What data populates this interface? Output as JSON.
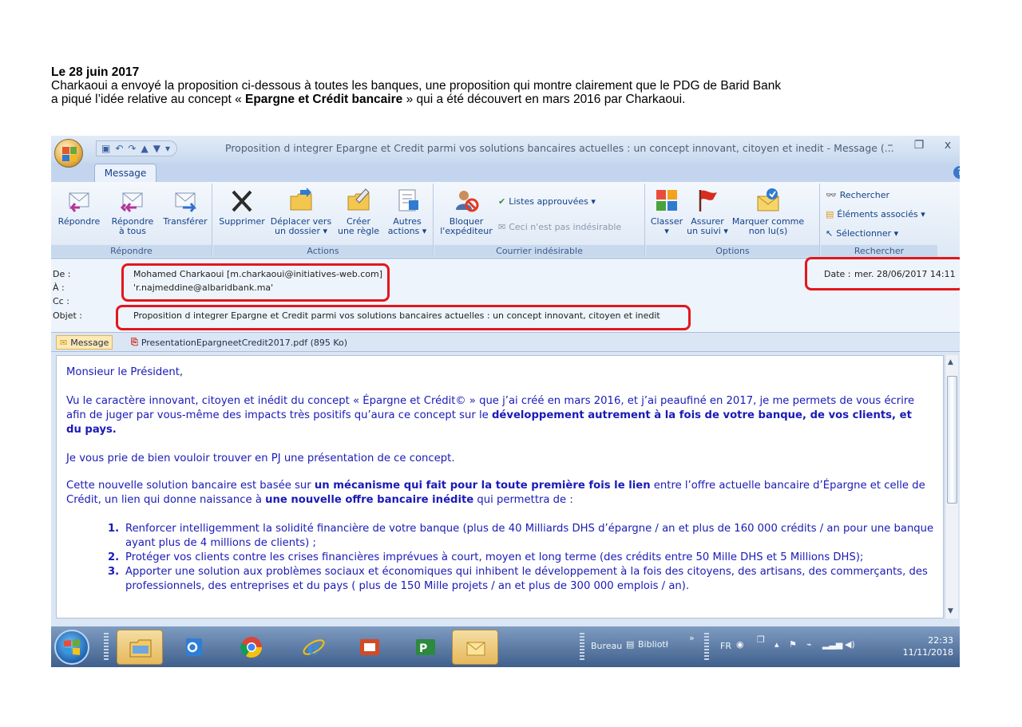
{
  "intro": {
    "date": "Le 28 juin 2017",
    "line1": "Charkaoui a envoyé la proposition ci-dessous à toutes les banques, une proposition qui montre clairement que le PDG de Barid Bank",
    "line2_pre": "a piqué l’idée relative au concept « ",
    "line2_bold": "Epargne et Crédit bancaire",
    "line2_post": " » qui a été découvert en mars 2016 par Charkaoui."
  },
  "window": {
    "title": "Proposition d integrer Epargne et Credit parmi vos solutions bancaires actuelles : un concept innovant, citoyen et inedit  - Message (...",
    "minimize": "–",
    "restore": "❐",
    "close": "x",
    "tab": "Message",
    "help": "?"
  },
  "ribbon": {
    "repondre": {
      "label": "Répondre",
      "reply": "Répondre",
      "reply_all_1": "Répondre",
      "reply_all_2": "à tous",
      "forward": "Transférer"
    },
    "actions": {
      "label": "Actions",
      "delete": "Supprimer",
      "move_1": "Déplacer vers",
      "move_2": "un dossier ▾",
      "rule_1": "Créer",
      "rule_2": "une règle",
      "other_1": "Autres",
      "other_2": "actions ▾"
    },
    "junk": {
      "label": "Courrier indésirable",
      "block_1": "Bloquer",
      "block_2": "l'expéditeur",
      "safe_lists": "Listes approuvées ▾",
      "not_junk": "Ceci n'est pas indésirable"
    },
    "options": {
      "label": "Options",
      "classify_1": "Classer",
      "classify_2": "▾",
      "followup_1": "Assurer",
      "followup_2": "un suivi ▾",
      "unread_1": "Marquer comme",
      "unread_2": "non lu(s)"
    },
    "search": {
      "label": "Rechercher",
      "find": "Rechercher",
      "related": "Éléments associés ▾",
      "select": "Sélectionner ▾"
    }
  },
  "header": {
    "from_label": "De :",
    "from_value": "Mohamed Charkaoui  [m.charkaoui@initiatives-web.com]",
    "to_label": "À :",
    "to_value": "'r.najmeddine@albaridbank.ma'",
    "cc_label": "Cc :",
    "subject_label": "Objet :",
    "subject_value": "Proposition d integrer Epargne et Credit parmi vos solutions bancaires actuelles : un concept innovant, citoyen et inedit",
    "date_label": "Date :",
    "date_value": "mer. 28/06/2017 14:11"
  },
  "attachments": {
    "message_tab": "Message",
    "file": "PresentationEpargneetCredit2017.pdf (895 Ko)"
  },
  "body": {
    "greeting": "Monsieur le Président,",
    "p1_text": "Vu le caractère innovant, citoyen et inédit du  concept « Épargne et Crédit© » que j’ai créé en mars 2016, et j’ai peaufiné en 2017, je me permets de vous écrire afin de juger par vous-même des impacts très positifs qu’aura ce concept sur le ",
    "p1_bold": "développement autrement à la fois de votre banque, de vos clients, et du pays.",
    "p2": "Je vous prie de bien vouloir trouver en PJ une présentation de ce concept.",
    "p3_a": "Cette nouvelle solution bancaire est basée sur ",
    "p3_b": "un mécanisme qui fait pour la toute première fois le lien",
    "p3_c": " entre l’offre actuelle bancaire  d’Épargne et celle de Crédit, un lien qui  donne naissance à ",
    "p3_d": "une nouvelle offre bancaire inédite",
    "p3_e": " qui permettra de :",
    "items": [
      {
        "num": "1.",
        "text": "Renforcer intelligemment la solidité financière de votre banque (plus de 40 Milliards DHS d’épargne / an et plus de 160 000 crédits / an pour une banque ayant plus de 4 millions de clients) ;"
      },
      {
        "num": "2.",
        "text": "Protéger vos clients contre les crises financières imprévues à court, moyen et long terme (des crédits entre 50 Mille DHS et 5 Millions DHS);"
      },
      {
        "num": "3.",
        "text": "Apporter une solution  aux problèmes sociaux et économiques qui inhibent le développement à la fois des  citoyens, des artisans, des commerçants, des professionnels, des entreprises et du pays ( plus de 150 Mille projets / an et plus de 300 000 emplois / an)."
      }
    ]
  },
  "taskbar": {
    "bureau": "Bureau",
    "biblio": "Bibliotł",
    "chevron": "»",
    "lang": "FR",
    "time": "22:33",
    "date": "11/11/2018"
  },
  "colors": {
    "highlight_box": "#e3171d",
    "body_text": "#1a1ab8",
    "ribbon_text": "#15428b"
  }
}
